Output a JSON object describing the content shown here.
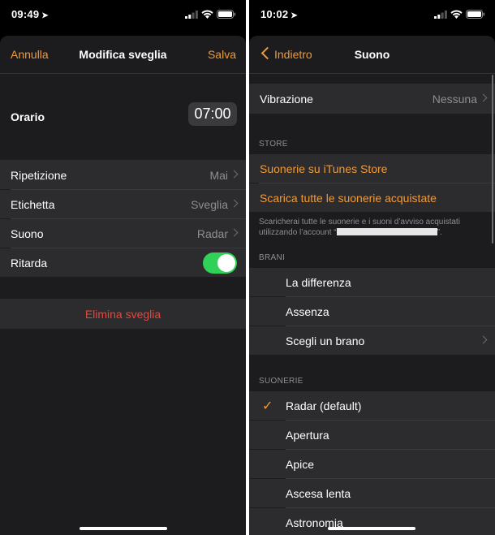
{
  "left": {
    "status": {
      "time": "09:49",
      "location_icon": "location-arrow-icon"
    },
    "nav": {
      "cancel": "Annulla",
      "title": "Modifica sveglia",
      "save": "Salva"
    },
    "time_row": {
      "label": "Orario",
      "value": "07:00"
    },
    "rows": [
      {
        "label": "Ripetizione",
        "value": "Mai"
      },
      {
        "label": "Etichetta",
        "value": "Sveglia"
      },
      {
        "label": "Suono",
        "value": "Radar"
      }
    ],
    "snooze": {
      "label": "Ritarda",
      "on": true
    },
    "delete": "Elimina sveglia"
  },
  "right": {
    "status": {
      "time": "10:02",
      "location_icon": "location-arrow-icon"
    },
    "nav": {
      "back": "Indietro",
      "title": "Suono"
    },
    "vibration": {
      "label": "Vibrazione",
      "value": "Nessuna"
    },
    "store": {
      "header": "STORE",
      "items": [
        "Suonerie su iTunes Store",
        "Scarica tutte le suonerie acquistate"
      ],
      "note_line1": "Scaricherai tutte le suonerie e i suoni d’avviso acquistati",
      "note_line2_prefix": "utilizzando l’account “",
      "note_line2_suffix": "”."
    },
    "songs": {
      "header": "BRANI",
      "items": [
        "La differenza",
        "Assenza",
        "Scegli un brano"
      ]
    },
    "ringtones": {
      "header": "SUONERIE",
      "items": [
        "Radar (default)",
        "Apertura",
        "Apice",
        "Ascesa lenta",
        "Astronomia"
      ],
      "selected": "Radar (default)"
    }
  },
  "colors": {
    "accent": "#f09a37",
    "toggle_on": "#30d158",
    "destructive": "#e5483c",
    "background": "#1c1c1e",
    "cell": "#2c2c2e"
  }
}
